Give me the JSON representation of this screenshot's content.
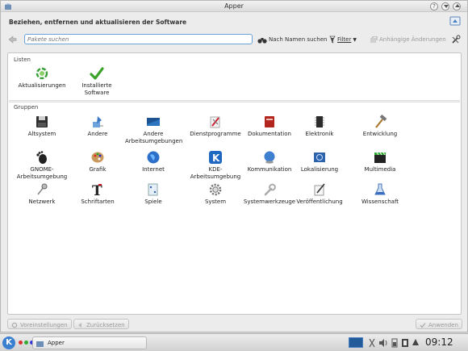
{
  "window": {
    "title": "Apper"
  },
  "header": {
    "heading": "Beziehen, entfernen und aktualisieren der Software"
  },
  "toolbar": {
    "search_placeholder": "Pakete suchen",
    "search_mode_label": "Nach Namen suchen",
    "filter_label": "Filter",
    "pending_label": "Anhängige Änderungen"
  },
  "lists": {
    "label": "Listen",
    "items": [
      {
        "label": "Aktualisierungen",
        "icon": "updates-icon"
      },
      {
        "label": "Installierte Software",
        "icon": "checkmark-icon"
      }
    ]
  },
  "groups": {
    "label": "Gruppen",
    "items": [
      {
        "label": "Altsystem",
        "icon": "floppy-disk-icon"
      },
      {
        "label": "Andere",
        "icon": "paint-icon"
      },
      {
        "label": "Andere Arbeitsumgebungen",
        "icon": "desktop-icon"
      },
      {
        "label": "Dienstprogramme",
        "icon": "tools-icon"
      },
      {
        "label": "Dokumentation",
        "icon": "book-icon"
      },
      {
        "label": "Elektronik",
        "icon": "chip-icon"
      },
      {
        "label": "Entwicklung",
        "icon": "hammer-icon"
      },
      {
        "label": "GNOME-Arbeitsumgebung",
        "icon": "gnome-foot-icon"
      },
      {
        "label": "Grafik",
        "icon": "palette-icon"
      },
      {
        "label": "Internet",
        "icon": "globe-icon"
      },
      {
        "label": "KDE-Arbeitsumgebung",
        "icon": "kde-icon"
      },
      {
        "label": "Kommunikation",
        "icon": "communication-icon"
      },
      {
        "label": "Lokalisierung",
        "icon": "flag-icon"
      },
      {
        "label": "Multimedia",
        "icon": "clapperboard-icon"
      },
      {
        "label": "Netzwerk",
        "icon": "network-icon"
      },
      {
        "label": "Schriftarten",
        "icon": "font-icon"
      },
      {
        "label": "Spiele",
        "icon": "dice-icon"
      },
      {
        "label": "System",
        "icon": "gear-icon"
      },
      {
        "label": "Systemwerkzeuge",
        "icon": "wrench-icon"
      },
      {
        "label": "Veröffentlichung",
        "icon": "publishing-icon"
      },
      {
        "label": "Wissenschaft",
        "icon": "flask-icon"
      }
    ]
  },
  "footer": {
    "settings_label": "Voreinstellungen",
    "reset_label": "Zurücksetzen",
    "apply_label": "Anwenden"
  },
  "taskbar": {
    "task_label": "Apper",
    "clock": "09:12"
  }
}
